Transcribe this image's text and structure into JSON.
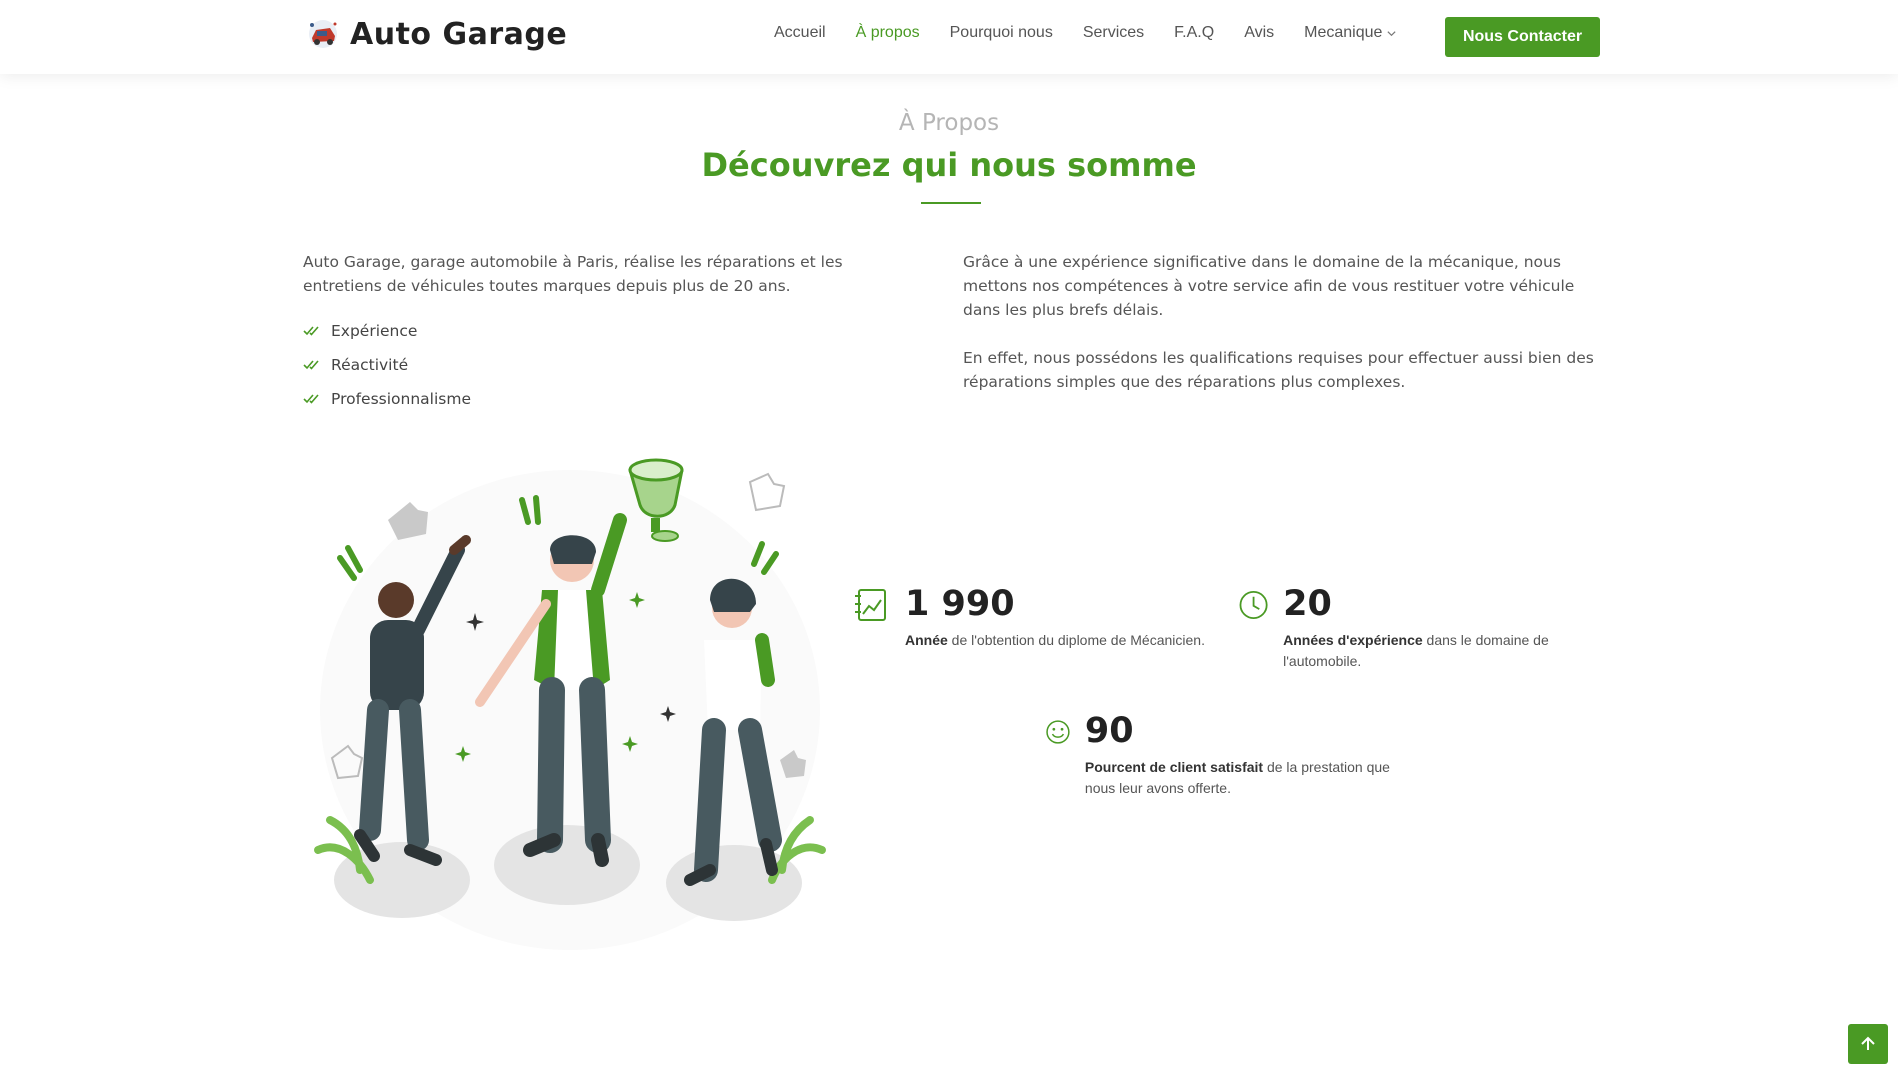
{
  "header": {
    "logo_text": "Auto Garage",
    "nav": [
      {
        "label": "Accueil",
        "active": false
      },
      {
        "label": "À propos",
        "active": true
      },
      {
        "label": "Pourquoi nous",
        "active": false
      },
      {
        "label": "Services",
        "active": false
      },
      {
        "label": "F.A.Q",
        "active": false
      },
      {
        "label": "Avis",
        "active": false
      },
      {
        "label": "Mecanique",
        "active": false,
        "dropdown": true
      }
    ],
    "cta": "Nous Contacter"
  },
  "about": {
    "label": "À Propos",
    "title": "Découvrez qui nous somme",
    "intro": "Auto Garage, garage automobile à Paris, réalise les réparations et les entretiens de véhicules toutes marques depuis plus de 20 ans.",
    "checklist": [
      "Expérience",
      "Réactivité",
      "Professionnalisme"
    ],
    "right_p1": "Grâce à une expérience significative dans le domaine de la mécanique, nous mettons nos compétences à votre service afin de vous restituer votre véhicule dans les plus brefs délais.",
    "right_p2": "En effet, nous possédons les qualifications requises pour effectuer aussi bien des réparations simples que des réparations plus complexes."
  },
  "stats": [
    {
      "icon": "document-chart-icon",
      "number": "1 990",
      "bold": "Année",
      "text": " de l'obtention du diplome de Mécanicien."
    },
    {
      "icon": "clock-icon",
      "number": "20",
      "bold": "Années d'expérience",
      "text": " dans le domaine de l'automobile."
    },
    {
      "icon": "smiley-icon",
      "number": "90",
      "bold": "Pourcent de client satisfait",
      "text": " de la prestation que nous leur avons offerte."
    }
  ],
  "colors": {
    "accent": "#4a9a24",
    "muted_label": "#b5b5b5"
  }
}
